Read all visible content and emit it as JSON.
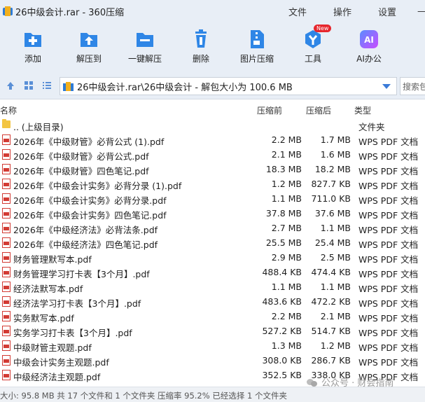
{
  "window": {
    "title": "26中级会计.rar - 360压缩",
    "menu": [
      "文件",
      "操作",
      "设置",
      "—"
    ]
  },
  "toolbar": {
    "items": [
      {
        "label": "添加",
        "icon": "add-icon"
      },
      {
        "label": "解压到",
        "icon": "extract-to-icon"
      },
      {
        "label": "一键解压",
        "icon": "one-click-extract-icon"
      },
      {
        "label": "删除",
        "icon": "delete-icon"
      },
      {
        "label": "图片压缩",
        "icon": "image-compress-icon"
      },
      {
        "label": "工具",
        "icon": "tools-icon",
        "badge": "New"
      },
      {
        "label": "AI办公",
        "icon": "ai-office-icon",
        "glyph": "AI"
      }
    ]
  },
  "address": {
    "path": "26中级会计.rar\\26中级会计 - 解包大小为 100.6 MB",
    "search_placeholder": "搜索包"
  },
  "columns": {
    "name": "名称",
    "before": "压缩前",
    "after": "压缩后",
    "type": "类型"
  },
  "files": [
    {
      "name": ".. (上级目录)",
      "before": "",
      "after": "",
      "type": "文件夹",
      "kind": "folder"
    },
    {
      "name": "2026年《中级财管》必背公式 (1).pdf",
      "before": "2.2 MB",
      "after": "1.7 MB",
      "type": "WPS PDF 文档",
      "kind": "pdf"
    },
    {
      "name": "2026年《中级财管》必背公式.pdf",
      "before": "2.1 MB",
      "after": "1.6 MB",
      "type": "WPS PDF 文档",
      "kind": "pdf"
    },
    {
      "name": "2026年《中级财管》四色笔记.pdf",
      "before": "18.3 MB",
      "after": "18.2 MB",
      "type": "WPS PDF 文档",
      "kind": "pdf"
    },
    {
      "name": "2026年《中级会计实务》必背分录 (1).pdf",
      "before": "1.2 MB",
      "after": "827.7 KB",
      "type": "WPS PDF 文档",
      "kind": "pdf"
    },
    {
      "name": "2026年《中级会计实务》必背分录.pdf",
      "before": "1.1 MB",
      "after": "711.0 KB",
      "type": "WPS PDF 文档",
      "kind": "pdf"
    },
    {
      "name": "2026年《中级会计实务》四色笔记.pdf",
      "before": "37.8 MB",
      "after": "37.6 MB",
      "type": "WPS PDF 文档",
      "kind": "pdf"
    },
    {
      "name": "2026年《中级经济法》必背法条.pdf",
      "before": "2.7 MB",
      "after": "1.1 MB",
      "type": "WPS PDF 文档",
      "kind": "pdf"
    },
    {
      "name": "2026年《中级经济法》四色笔记.pdf",
      "before": "25.5 MB",
      "after": "25.4 MB",
      "type": "WPS PDF 文档",
      "kind": "pdf"
    },
    {
      "name": "财务管理默写本.pdf",
      "before": "2.9 MB",
      "after": "2.5 MB",
      "type": "WPS PDF 文档",
      "kind": "pdf"
    },
    {
      "name": "财务管理学习打卡表【3个月】.pdf",
      "before": "488.4 KB",
      "after": "474.4 KB",
      "type": "WPS PDF 文档",
      "kind": "pdf"
    },
    {
      "name": "经济法默写本.pdf",
      "before": "1.1 MB",
      "after": "1.1 MB",
      "type": "WPS PDF 文档",
      "kind": "pdf"
    },
    {
      "name": "经济法学习打卡表【3个月】.pdf",
      "before": "483.6 KB",
      "after": "472.2 KB",
      "type": "WPS PDF 文档",
      "kind": "pdf"
    },
    {
      "name": "实务默写本.pdf",
      "before": "2.2 MB",
      "after": "2.1 MB",
      "type": "WPS PDF 文档",
      "kind": "pdf"
    },
    {
      "name": "实务学习打卡表【3个月】.pdf",
      "before": "527.2 KB",
      "after": "514.7 KB",
      "type": "WPS PDF 文档",
      "kind": "pdf"
    },
    {
      "name": "中级财管主观题.pdf",
      "before": "1.3 MB",
      "after": "1.2 MB",
      "type": "WPS PDF 文档",
      "kind": "pdf"
    },
    {
      "name": "中级会计实务主观题.pdf",
      "before": "308.0 KB",
      "after": "286.7 KB",
      "type": "WPS PDF 文档",
      "kind": "pdf"
    },
    {
      "name": "中级经济法主观题.pdf",
      "before": "352.5 KB",
      "after": "338.0 KB",
      "type": "WPS PDF 文档",
      "kind": "pdf"
    }
  ],
  "status": {
    "text": "大小: 95.8 MB 共 17 个文件和 1 个文件夹 压缩率 95.2% 已经选择 1 个文件夹"
  },
  "watermark": {
    "text": "公众号 · 财会指南"
  },
  "colors": {
    "chrome_bg": "#e8eef6",
    "accent_blue": "#2e7bd6",
    "pdf_red": "#d23a33",
    "folder_yellow": "#f3c543"
  }
}
